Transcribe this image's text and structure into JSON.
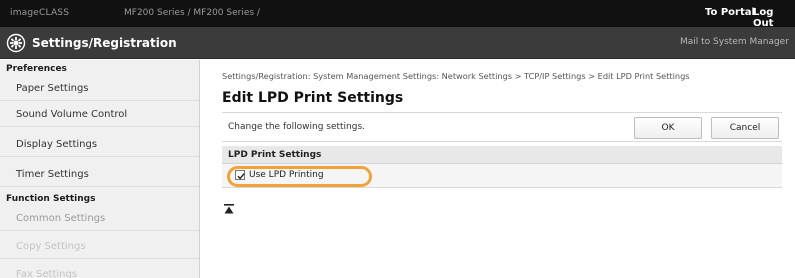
{
  "topbar": {
    "product": "imageCLASS",
    "model": "MF200 Series / MF200 Series /",
    "portal_link": "To Portal",
    "logout_link": "Log Out"
  },
  "titlebar": {
    "icon": "settings-gear-icon",
    "title": "Settings/Registration",
    "mail_link": "Mail to System Manager"
  },
  "sidebar": {
    "sections": [
      {
        "heading": "Preferences",
        "items": [
          "Paper Settings",
          "Sound Volume Control",
          "Display Settings",
          "Timer Settings"
        ]
      },
      {
        "heading": "Function Settings",
        "items": [
          "Common Settings",
          "Copy Settings",
          "Fax Settings"
        ]
      }
    ]
  },
  "main": {
    "breadcrumb": "Settings/Registration: System Management Settings: Network Settings > TCP/IP Settings > Edit LPD Print Settings",
    "title": "Edit LPD Print Settings",
    "instruction": "Change the following settings.",
    "ok_label": "OK",
    "cancel_label": "Cancel",
    "section_heading": "LPD Print Settings",
    "option_label": "Use LPD Printing",
    "option_checked": true,
    "highlight_color": "#f2a23a",
    "to_top_icon": "to-top-icon"
  }
}
